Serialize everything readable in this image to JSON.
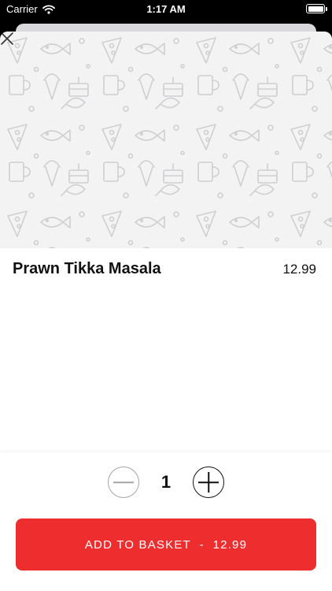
{
  "status_bar": {
    "carrier": "Carrier",
    "time": "1:17 AM"
  },
  "item": {
    "name": "Prawn Tikka Masala",
    "price": "12.99"
  },
  "quantity": {
    "value": "1"
  },
  "add_to_basket": {
    "label": "ADD TO BASKET",
    "separator": "  -  ",
    "price": "12.99"
  },
  "colors": {
    "accent": "#ee2e2e",
    "hero_bg": "#f3f3f4",
    "doodle": "#cfcfd2"
  },
  "icons": {
    "close": "close-icon",
    "minus": "minus-icon",
    "plus": "plus-icon",
    "wifi": "wifi-icon",
    "battery": "battery-icon"
  }
}
